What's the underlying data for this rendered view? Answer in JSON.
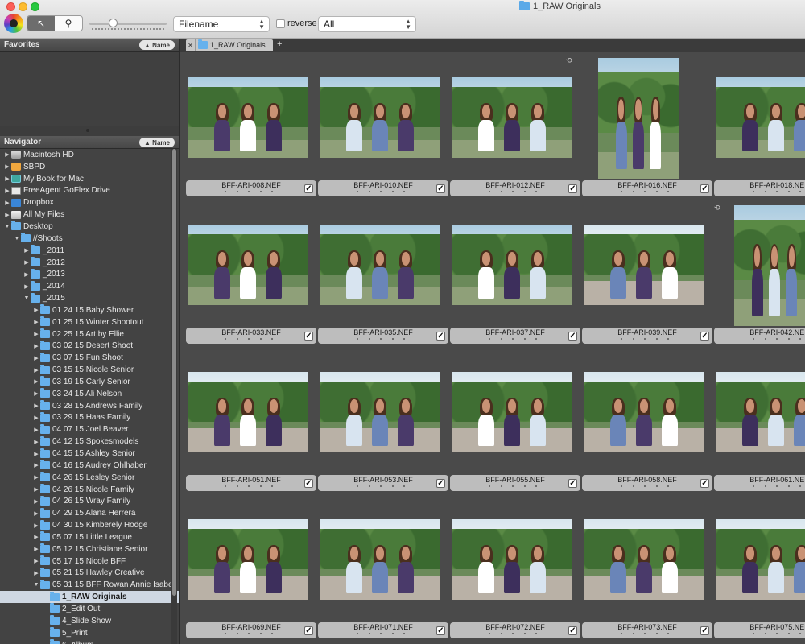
{
  "window": {
    "title": "1_RAW Originals"
  },
  "toolbar": {
    "tools": [
      {
        "name": "select-tool",
        "glyph": "↖"
      },
      {
        "name": "zoom-tool",
        "glyph": "⚲"
      }
    ],
    "thumbnail_size_level": 0.3,
    "sort": {
      "value": "Filename"
    },
    "reverse": {
      "label": "reverse",
      "checked": false
    },
    "filter": {
      "value": "All"
    }
  },
  "sidebar": {
    "favorites": {
      "title": "Favorites",
      "sort_label": "Name"
    },
    "navigator": {
      "title": "Navigator",
      "sort_label": "Name"
    },
    "tree": [
      {
        "label": "Macintosh HD",
        "indent": 0,
        "expand": "collapsed",
        "icon": "drive"
      },
      {
        "label": "SBPD",
        "indent": 0,
        "expand": "collapsed",
        "icon": "orange"
      },
      {
        "label": "My Book for Mac",
        "indent": 0,
        "expand": "collapsed",
        "icon": "teal"
      },
      {
        "label": "FreeAgent GoFlex Drive",
        "indent": 0,
        "expand": "collapsed",
        "icon": "ga"
      },
      {
        "label": "Dropbox",
        "indent": 0,
        "expand": "collapsed",
        "icon": "dropbox"
      },
      {
        "label": "All My Files",
        "indent": 0,
        "expand": "collapsed",
        "icon": "files"
      },
      {
        "label": "Desktop",
        "indent": 0,
        "expand": "expanded",
        "icon": "folder"
      },
      {
        "label": "//Shoots",
        "indent": 1,
        "expand": "expanded",
        "icon": "folder"
      },
      {
        "label": "_2011",
        "indent": 2,
        "expand": "collapsed",
        "icon": "folder"
      },
      {
        "label": "_2012",
        "indent": 2,
        "expand": "collapsed",
        "icon": "folder"
      },
      {
        "label": "_2013",
        "indent": 2,
        "expand": "collapsed",
        "icon": "folder"
      },
      {
        "label": "_2014",
        "indent": 2,
        "expand": "collapsed",
        "icon": "folder"
      },
      {
        "label": "_2015",
        "indent": 2,
        "expand": "expanded",
        "icon": "folder"
      },
      {
        "label": "01 24 15 Baby Shower",
        "indent": 3,
        "expand": "collapsed",
        "icon": "folder"
      },
      {
        "label": "01 25 15 Winter Shootout",
        "indent": 3,
        "expand": "collapsed",
        "icon": "folder"
      },
      {
        "label": "02 25 15 Art by Ellie",
        "indent": 3,
        "expand": "collapsed",
        "icon": "folder"
      },
      {
        "label": "03 02 15 Desert Shoot",
        "indent": 3,
        "expand": "collapsed",
        "icon": "folder"
      },
      {
        "label": "03 07 15 Fun Shoot",
        "indent": 3,
        "expand": "collapsed",
        "icon": "folder"
      },
      {
        "label": "03 15 15 Nicole Senior",
        "indent": 3,
        "expand": "collapsed",
        "icon": "folder"
      },
      {
        "label": "03 19 15 Carly Senior",
        "indent": 3,
        "expand": "collapsed",
        "icon": "folder"
      },
      {
        "label": "03 24 15 Ali Nelson",
        "indent": 3,
        "expand": "collapsed",
        "icon": "folder"
      },
      {
        "label": "03 28 15 Andrews Family",
        "indent": 3,
        "expand": "collapsed",
        "icon": "folder"
      },
      {
        "label": "03 29 15 Haas Family",
        "indent": 3,
        "expand": "collapsed",
        "icon": "folder"
      },
      {
        "label": "04 07 15 Joel Beaver",
        "indent": 3,
        "expand": "collapsed",
        "icon": "folder"
      },
      {
        "label": "04 12 15 Spokesmodels",
        "indent": 3,
        "expand": "collapsed",
        "icon": "folder"
      },
      {
        "label": "04 15 15 Ashley Senior",
        "indent": 3,
        "expand": "collapsed",
        "icon": "folder"
      },
      {
        "label": "04 16 15 Audrey Ohlhaber",
        "indent": 3,
        "expand": "collapsed",
        "icon": "folder"
      },
      {
        "label": "04 26 15 Lesley Senior",
        "indent": 3,
        "expand": "collapsed",
        "icon": "folder"
      },
      {
        "label": "04 26 15 Nicole Family",
        "indent": 3,
        "expand": "collapsed",
        "icon": "folder"
      },
      {
        "label": "04 26 15 Wray Family",
        "indent": 3,
        "expand": "collapsed",
        "icon": "folder"
      },
      {
        "label": "04 29 15 Alana Herrera",
        "indent": 3,
        "expand": "collapsed",
        "icon": "folder"
      },
      {
        "label": "04 30 15 Kimberely Hodge",
        "indent": 3,
        "expand": "collapsed",
        "icon": "folder"
      },
      {
        "label": "05 07 15 Little League",
        "indent": 3,
        "expand": "collapsed",
        "icon": "folder"
      },
      {
        "label": "05 12 15 Christiane Senior",
        "indent": 3,
        "expand": "collapsed",
        "icon": "folder"
      },
      {
        "label": "05 17 15 Nicole BFF",
        "indent": 3,
        "expand": "collapsed",
        "icon": "folder"
      },
      {
        "label": "05 21 15 Hawley Creative",
        "indent": 3,
        "expand": "collapsed",
        "icon": "folder"
      },
      {
        "label": "05 31 15 BFF Rowan Annie Isabe",
        "indent": 3,
        "expand": "expanded",
        "icon": "folder"
      },
      {
        "label": "1_RAW Originals",
        "indent": 4,
        "expand": "none",
        "icon": "folder",
        "selected": true
      },
      {
        "label": "2_Edit Out",
        "indent": 4,
        "expand": "none",
        "icon": "folder"
      },
      {
        "label": "4_Slide Show",
        "indent": 4,
        "expand": "none",
        "icon": "folder"
      },
      {
        "label": "5_Print",
        "indent": 4,
        "expand": "none",
        "icon": "folder"
      },
      {
        "label": "6_Album",
        "indent": 4,
        "expand": "none",
        "icon": "folder"
      }
    ]
  },
  "browser": {
    "tab": {
      "label": "1_RAW Originals",
      "close_glyph": "✕",
      "add_glyph": "+"
    },
    "thumbnails": [
      {
        "file": "BFF-ARI-008.NEF",
        "orientation": "landscape",
        "scene": "garden",
        "checked": true
      },
      {
        "file": "BFF-ARI-010.NEF",
        "orientation": "landscape",
        "scene": "garden",
        "checked": true
      },
      {
        "file": "BFF-ARI-012.NEF",
        "orientation": "landscape",
        "scene": "garden",
        "checked": true
      },
      {
        "file": "BFF-ARI-016.NEF",
        "orientation": "portrait",
        "scene": "steps",
        "checked": true,
        "rotated_badge": true
      },
      {
        "file": "BFF-ARI-018.NEF",
        "orientation": "landscape",
        "scene": "steps",
        "checked": false
      },
      {
        "file": "BFF-ARI-033.NEF",
        "orientation": "landscape",
        "scene": "garden",
        "checked": true
      },
      {
        "file": "BFF-ARI-035.NEF",
        "orientation": "landscape",
        "scene": "garden",
        "checked": true
      },
      {
        "file": "BFF-ARI-037.NEF",
        "orientation": "landscape",
        "scene": "garden",
        "checked": true
      },
      {
        "file": "BFF-ARI-039.NEF",
        "orientation": "landscape",
        "scene": "plaza",
        "checked": true
      },
      {
        "file": "BFF-ARI-042.NEF",
        "orientation": "portrait",
        "scene": "garden",
        "checked": false,
        "rotated_badge": true
      },
      {
        "file": "BFF-ARI-051.NEF",
        "orientation": "landscape",
        "scene": "plaza",
        "checked": true
      },
      {
        "file": "BFF-ARI-053.NEF",
        "orientation": "landscape",
        "scene": "plaza",
        "checked": true
      },
      {
        "file": "BFF-ARI-055.NEF",
        "orientation": "landscape",
        "scene": "plaza",
        "checked": true
      },
      {
        "file": "BFF-ARI-058.NEF",
        "orientation": "landscape",
        "scene": "plaza",
        "checked": true
      },
      {
        "file": "BFF-ARI-061.NEF",
        "orientation": "landscape",
        "scene": "plaza",
        "checked": false
      },
      {
        "file": "BFF-ARI-069.NEF",
        "orientation": "landscape",
        "scene": "plaza",
        "checked": true
      },
      {
        "file": "BFF-ARI-071.NEF",
        "orientation": "landscape",
        "scene": "plaza",
        "checked": true
      },
      {
        "file": "BFF-ARI-072.NEF",
        "orientation": "landscape",
        "scene": "plaza",
        "checked": true
      },
      {
        "file": "BFF-ARI-073.NEF",
        "orientation": "landscape",
        "scene": "plaza",
        "checked": true
      },
      {
        "file": "BFF-ARI-075.NEF",
        "orientation": "landscape",
        "scene": "plaza",
        "checked": false
      }
    ]
  },
  "colors": {
    "selection": "#cfd8e3",
    "folder": "#67b1ec",
    "outfits": [
      "#4a3a6a",
      "#d8e4f0",
      "#ffffff",
      "#6a85b8",
      "#3d2f5c"
    ]
  }
}
